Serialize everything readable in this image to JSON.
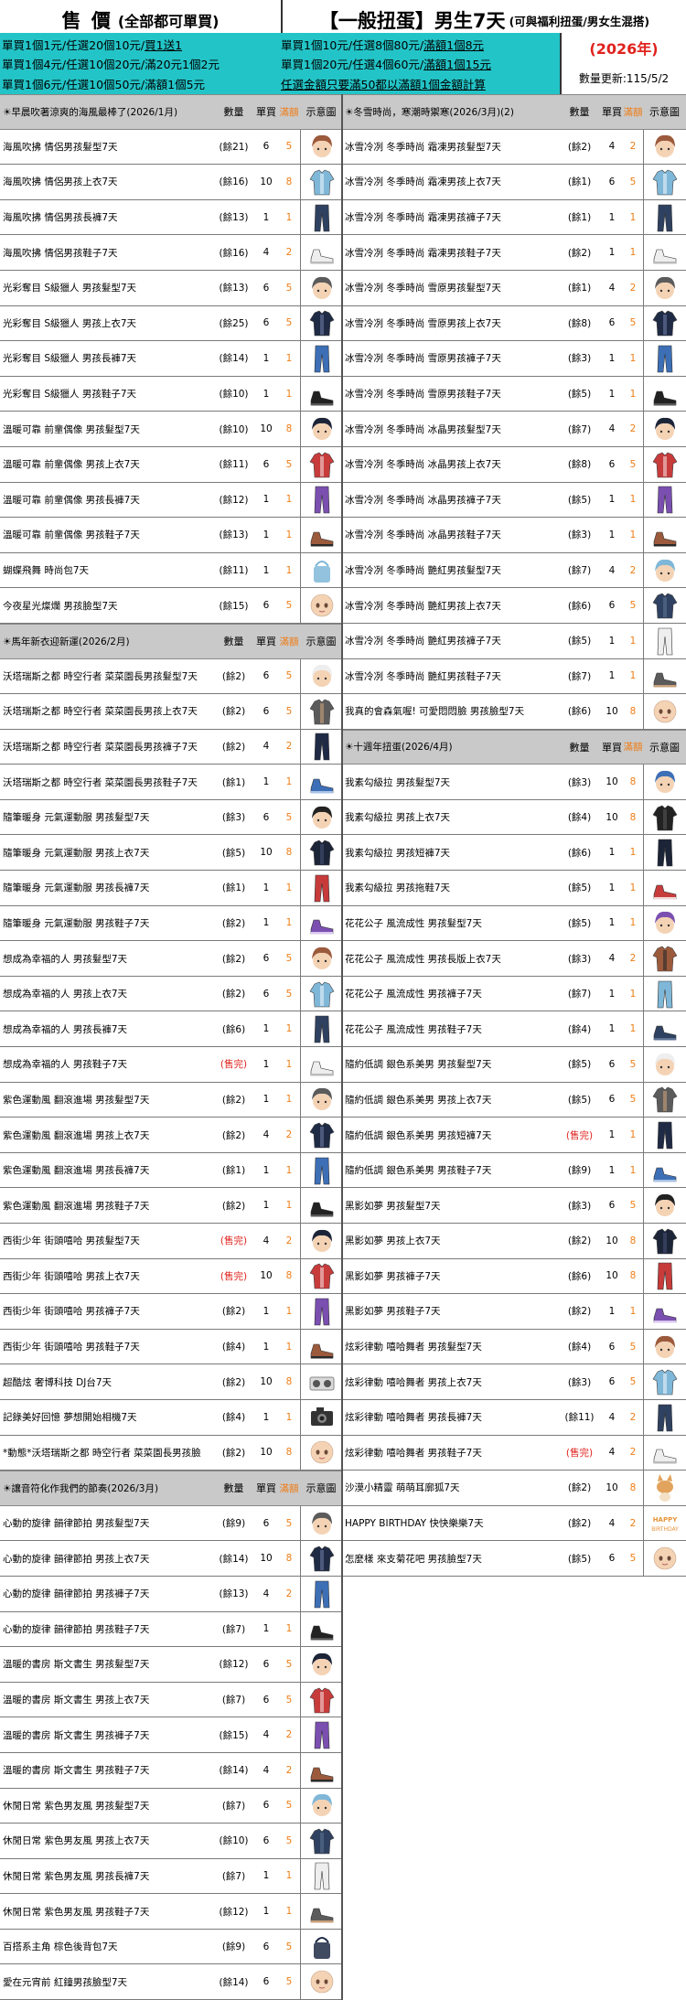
{
  "header": {
    "left_title": "售 價",
    "left_title_sub": "(全部都可單買)",
    "right_title": "【一般扭蛋】男生7天",
    "right_title_sub": "(可與福利扭蛋/男女生混搭)",
    "year": "(2026年)",
    "update": "數量更新:115/5/2",
    "left_lines": [
      {
        "a": "單買1個1元/任選20個10元/",
        "b": "買1送1"
      },
      {
        "a": "單買1個4元/任選10個20元/滿20元1個2元",
        "b": ""
      },
      {
        "a": "單買1個6元/任選10個50元/滿額1個5元",
        "b": ""
      }
    ],
    "right_lines": [
      {
        "a": "單買1個10元/任選8個80元/",
        "b": "滿額1個8元"
      },
      {
        "a": "單買1個20元/任選4個60元/",
        "b": "滿額1個15元"
      },
      {
        "a": "",
        "b": "任選金額只要滿50都以滿額1個金額計算"
      }
    ]
  },
  "columns": {
    "qty": "數量",
    "price": "單買",
    "full": "滿額",
    "img": "示意圖"
  },
  "left_sections": [
    {
      "title": "☀早晨吹著涼爽的海風最棒了(2026/1月)",
      "rows": [
        {
          "name": "海風吹拂 情侶男孩髮型7天",
          "qty": "(餘21)",
          "price": "6",
          "full": "5",
          "thumb": "hair"
        },
        {
          "name": "海風吹拂 情侶男孩上衣7天",
          "qty": "(餘16)",
          "price": "10",
          "full": "8",
          "thumb": "top"
        },
        {
          "name": "海風吹拂 情侶男孩長褲7天",
          "qty": "(餘13)",
          "price": "1",
          "full": "1",
          "thumb": "pants"
        },
        {
          "name": "海風吹拂 情侶男孩鞋子7天",
          "qty": "(餘16)",
          "price": "4",
          "full": "2",
          "thumb": "shoes"
        },
        {
          "name": "光彩奪目 S級獵人 男孩髮型7天",
          "qty": "(餘13)",
          "price": "6",
          "full": "5",
          "thumb": "hair"
        },
        {
          "name": "光彩奪目 S級獵人 男孩上衣7天",
          "qty": "(餘25)",
          "price": "6",
          "full": "5",
          "thumb": "top"
        },
        {
          "name": "光彩奪目 S級獵人 男孩長褲7天",
          "qty": "(餘14)",
          "price": "1",
          "full": "1",
          "thumb": "pants"
        },
        {
          "name": "光彩奪目 S級獵人 男孩鞋子7天",
          "qty": "(餘10)",
          "price": "1",
          "full": "1",
          "thumb": "shoes"
        },
        {
          "name": "溫暖可靠 前輩偶像 男孩髮型7天",
          "qty": "(餘10)",
          "price": "10",
          "full": "8",
          "thumb": "hair"
        },
        {
          "name": "溫暖可靠 前輩偶像 男孩上衣7天",
          "qty": "(餘11)",
          "price": "6",
          "full": "5",
          "thumb": "top"
        },
        {
          "name": "溫暖可靠 前輩偶像 男孩長褲7天",
          "qty": "(餘12)",
          "price": "1",
          "full": "1",
          "thumb": "pants"
        },
        {
          "name": "溫暖可靠 前輩偶像 男孩鞋子7天",
          "qty": "(餘13)",
          "price": "1",
          "full": "1",
          "thumb": "shoes"
        },
        {
          "name": "蝴蝶飛舞 時尚包7天",
          "qty": "(餘11)",
          "price": "1",
          "full": "1",
          "thumb": "bag"
        },
        {
          "name": "今夜星光燦爛 男孩臉型7天",
          "qty": "(餘15)",
          "price": "6",
          "full": "5",
          "thumb": "face"
        }
      ]
    },
    {
      "title": "☀馬年新衣迎新運(2026/2月)",
      "rows": [
        {
          "name": "沃塔瑞斯之都 時空行者 菜菜園長男孩髮型7天",
          "qty": "(餘2)",
          "price": "6",
          "full": "5",
          "thumb": "hair"
        },
        {
          "name": "沃塔瑞斯之都 時空行者 菜菜園長男孩上衣7天",
          "qty": "(餘2)",
          "price": "6",
          "full": "5",
          "thumb": "top"
        },
        {
          "name": "沃塔瑞斯之都 時空行者 菜菜園長男孩褲子7天",
          "qty": "(餘2)",
          "price": "4",
          "full": "2",
          "thumb": "pants"
        },
        {
          "name": "沃塔瑞斯之都 時空行者 菜菜園長男孩鞋子7天",
          "qty": "(餘1)",
          "price": "1",
          "full": "1",
          "thumb": "shoes"
        },
        {
          "name": "隨筆暖身 元氣運動服 男孩髮型7天",
          "qty": "(餘3)",
          "price": "6",
          "full": "5",
          "thumb": "hair"
        },
        {
          "name": "隨筆暖身 元氣運動服 男孩上衣7天",
          "qty": "(餘5)",
          "price": "10",
          "full": "8",
          "thumb": "top"
        },
        {
          "name": "隨筆暖身 元氣運動服 男孩長褲7天",
          "qty": "(餘1)",
          "price": "1",
          "full": "1",
          "thumb": "pants"
        },
        {
          "name": "隨筆暖身 元氣運動服 男孩鞋子7天",
          "qty": "(餘2)",
          "price": "1",
          "full": "1",
          "thumb": "shoes"
        },
        {
          "name": "想成為幸福的人 男孩髮型7天",
          "qty": "(餘2)",
          "price": "6",
          "full": "5",
          "thumb": "hair"
        },
        {
          "name": "想成為幸福的人 男孩上衣7天",
          "qty": "(餘2)",
          "price": "6",
          "full": "5",
          "thumb": "top"
        },
        {
          "name": "想成為幸福的人 男孩長褲7天",
          "qty": "(餘6)",
          "price": "1",
          "full": "1",
          "thumb": "pants"
        },
        {
          "name": "想成為幸福的人 男孩鞋子7天",
          "qty": "(售完)",
          "price": "1",
          "full": "1",
          "thumb": "shoes",
          "sold": true
        },
        {
          "name": "紫色運動風 翻滾進場 男孩髮型7天",
          "qty": "(餘2)",
          "price": "1",
          "full": "1",
          "thumb": "hair"
        },
        {
          "name": "紫色運動風 翻滾進場 男孩上衣7天",
          "qty": "(餘2)",
          "price": "4",
          "full": "2",
          "thumb": "top"
        },
        {
          "name": "紫色運動風 翻滾進場 男孩長褲7天",
          "qty": "(餘1)",
          "price": "1",
          "full": "1",
          "thumb": "pants"
        },
        {
          "name": "紫色運動風 翻滾進場 男孩鞋子7天",
          "qty": "(餘2)",
          "price": "1",
          "full": "1",
          "thumb": "shoes"
        },
        {
          "name": "西街少年 街頭嘻哈 男孩髮型7天",
          "qty": "(售完)",
          "price": "4",
          "full": "2",
          "thumb": "hair",
          "sold": true
        },
        {
          "name": "西街少年 街頭嘻哈 男孩上衣7天",
          "qty": "(售完)",
          "price": "10",
          "full": "8",
          "thumb": "top",
          "sold": true
        },
        {
          "name": "西街少年 街頭嘻哈 男孩褲子7天",
          "qty": "(餘2)",
          "price": "1",
          "full": "1",
          "thumb": "pants"
        },
        {
          "name": "西街少年 街頭嘻哈 男孩鞋子7天",
          "qty": "(餘4)",
          "price": "1",
          "full": "1",
          "thumb": "shoes"
        },
        {
          "name": "超酷炫 奢博科技 DJ台7天",
          "qty": "(餘2)",
          "price": "10",
          "full": "8",
          "thumb": "dj"
        },
        {
          "name": "記錄美好回憶 夢想開始相機7天",
          "qty": "(餘4)",
          "price": "1",
          "full": "1",
          "thumb": "camera"
        },
        {
          "name": "*動態*沃塔瑞斯之都 時空行者 菜菜園長男孩臉",
          "qty": "(餘2)",
          "price": "10",
          "full": "8",
          "thumb": "face"
        }
      ]
    },
    {
      "title": "☀讓音符化作我們的節奏(2026/3月)",
      "rows": [
        {
          "name": "心動的旋律 韻律節拍 男孩髮型7天",
          "qty": "(餘9)",
          "price": "6",
          "full": "5",
          "thumb": "hair"
        },
        {
          "name": "心動的旋律 韻律節拍 男孩上衣7天",
          "qty": "(餘14)",
          "price": "10",
          "full": "8",
          "thumb": "top"
        },
        {
          "name": "心動的旋律 韻律節拍 男孩褲子7天",
          "qty": "(餘13)",
          "price": "4",
          "full": "2",
          "thumb": "pants"
        },
        {
          "name": "心動的旋律 韻律節拍 男孩鞋子7天",
          "qty": "(餘7)",
          "price": "1",
          "full": "1",
          "thumb": "shoes"
        },
        {
          "name": "溫暖的書房 斯文書生 男孩髮型7天",
          "qty": "(餘12)",
          "price": "6",
          "full": "5",
          "thumb": "hair"
        },
        {
          "name": "溫暖的書房 斯文書生 男孩上衣7天",
          "qty": "(餘7)",
          "price": "6",
          "full": "5",
          "thumb": "top"
        },
        {
          "name": "溫暖的書房 斯文書生 男孩褲子7天",
          "qty": "(餘15)",
          "price": "4",
          "full": "2",
          "thumb": "pants"
        },
        {
          "name": "溫暖的書房 斯文書生 男孩鞋子7天",
          "qty": "(餘14)",
          "price": "4",
          "full": "2",
          "thumb": "shoes"
        },
        {
          "name": "休閒日常 紫色男友風 男孩髮型7天",
          "qty": "(餘7)",
          "price": "6",
          "full": "5",
          "thumb": "hair"
        },
        {
          "name": "休閒日常 紫色男友風 男孩上衣7天",
          "qty": "(餘10)",
          "price": "6",
          "full": "5",
          "thumb": "top"
        },
        {
          "name": "休閒日常 紫色男友風 男孩長褲7天",
          "qty": "(餘7)",
          "price": "1",
          "full": "1",
          "thumb": "pants"
        },
        {
          "name": "休閒日常 紫色男友風 男孩鞋子7天",
          "qty": "(餘12)",
          "price": "1",
          "full": "1",
          "thumb": "shoes"
        },
        {
          "name": "百搭系主角 棕色後背包7天",
          "qty": "(餘9)",
          "price": "6",
          "full": "5",
          "thumb": "bag"
        },
        {
          "name": "愛在元宵前 紅鐘男孩臉型7天",
          "qty": "(餘14)",
          "price": "6",
          "full": "5",
          "thumb": "face"
        }
      ]
    }
  ],
  "right_sections": [
    {
      "title": "☀冬雪時尚，寒潮時禦寒(2026/3月)(2)",
      "rows": [
        {
          "name": "冰雪冷冽 冬季時尚 霜凍男孩髮型7天",
          "qty": "(餘2)",
          "price": "4",
          "full": "2",
          "thumb": "hair"
        },
        {
          "name": "冰雪冷冽 冬季時尚 霜凍男孩上衣7天",
          "qty": "(餘1)",
          "price": "6",
          "full": "5",
          "thumb": "top"
        },
        {
          "name": "冰雪冷冽 冬季時尚 霜凍男孩褲子7天",
          "qty": "(餘1)",
          "price": "1",
          "full": "1",
          "thumb": "pants"
        },
        {
          "name": "冰雪冷冽 冬季時尚 霜凍男孩鞋子7天",
          "qty": "(餘2)",
          "price": "1",
          "full": "1",
          "thumb": "shoes"
        },
        {
          "name": "冰雪冷冽 冬季時尚 雪原男孩髮型7天",
          "qty": "(餘1)",
          "price": "4",
          "full": "2",
          "thumb": "hair"
        },
        {
          "name": "冰雪冷冽 冬季時尚 雪原男孩上衣7天",
          "qty": "(餘8)",
          "price": "6",
          "full": "5",
          "thumb": "top"
        },
        {
          "name": "冰雪冷冽 冬季時尚 雪原男孩褲子7天",
          "qty": "(餘3)",
          "price": "1",
          "full": "1",
          "thumb": "pants"
        },
        {
          "name": "冰雪冷冽 冬季時尚 雪原男孩鞋子7天",
          "qty": "(餘5)",
          "price": "1",
          "full": "1",
          "thumb": "shoes"
        },
        {
          "name": "冰雪冷冽 冬季時尚 冰晶男孩髮型7天",
          "qty": "(餘7)",
          "price": "4",
          "full": "2",
          "thumb": "hair"
        },
        {
          "name": "冰雪冷冽 冬季時尚 冰晶男孩上衣7天",
          "qty": "(餘8)",
          "price": "6",
          "full": "5",
          "thumb": "top"
        },
        {
          "name": "冰雪冷冽 冬季時尚 冰晶男孩褲子7天",
          "qty": "(餘5)",
          "price": "1",
          "full": "1",
          "thumb": "pants"
        },
        {
          "name": "冰雪冷冽 冬季時尚 冰晶男孩鞋子7天",
          "qty": "(餘3)",
          "price": "1",
          "full": "1",
          "thumb": "shoes"
        },
        {
          "name": "冰雪冷冽 冬季時尚 艷紅男孩髮型7天",
          "qty": "(餘7)",
          "price": "4",
          "full": "2",
          "thumb": "hair"
        },
        {
          "name": "冰雪冷冽 冬季時尚 艷紅男孩上衣7天",
          "qty": "(餘6)",
          "price": "6",
          "full": "5",
          "thumb": "top"
        },
        {
          "name": "冰雪冷冽 冬季時尚 艷紅男孩褲子7天",
          "qty": "(餘5)",
          "price": "1",
          "full": "1",
          "thumb": "pants"
        },
        {
          "name": "冰雪冷冽 冬季時尚 艷紅男孩鞋子7天",
          "qty": "(餘7)",
          "price": "1",
          "full": "1",
          "thumb": "shoes"
        },
        {
          "name": "我真的會森氣喔! 可愛悶悶臉 男孩臉型7天",
          "qty": "(餘6)",
          "price": "10",
          "full": "8",
          "thumb": "face"
        }
      ]
    },
    {
      "title": "☀十週年扭蛋(2026/4月)",
      "rows": [
        {
          "name": "我素勾級拉 男孩髮型7天",
          "qty": "(餘3)",
          "price": "10",
          "full": "8",
          "thumb": "hair"
        },
        {
          "name": "我素勾級拉 男孩上衣7天",
          "qty": "(餘4)",
          "price": "10",
          "full": "8",
          "thumb": "top"
        },
        {
          "name": "我素勾級拉 男孩短褲7天",
          "qty": "(餘6)",
          "price": "1",
          "full": "1",
          "thumb": "pants"
        },
        {
          "name": "我素勾級拉 男孩拖鞋7天",
          "qty": "(餘5)",
          "price": "1",
          "full": "1",
          "thumb": "shoes"
        },
        {
          "name": "花花公子 風流成性 男孩髮型7天",
          "qty": "(餘5)",
          "price": "1",
          "full": "1",
          "thumb": "hair"
        },
        {
          "name": "花花公子 風流成性 男孩長版上衣7天",
          "qty": "(餘3)",
          "price": "4",
          "full": "2",
          "thumb": "top"
        },
        {
          "name": "花花公子 風流成性 男孩褲子7天",
          "qty": "(餘7)",
          "price": "1",
          "full": "1",
          "thumb": "pants"
        },
        {
          "name": "花花公子 風流成性 男孩鞋子7天",
          "qty": "(餘4)",
          "price": "1",
          "full": "1",
          "thumb": "shoes"
        },
        {
          "name": "隨約低調 銀色系美男 男孩髮型7天",
          "qty": "(餘5)",
          "price": "6",
          "full": "5",
          "thumb": "hair"
        },
        {
          "name": "隨約低調 銀色系美男 男孩上衣7天",
          "qty": "(餘5)",
          "price": "6",
          "full": "5",
          "thumb": "top"
        },
        {
          "name": "隨約低調 銀色系美男 男孩短褲7天",
          "qty": "(售完)",
          "price": "1",
          "full": "1",
          "thumb": "pants",
          "sold": true
        },
        {
          "name": "隨約低調 銀色系美男 男孩鞋子7天",
          "qty": "(餘9)",
          "price": "1",
          "full": "1",
          "thumb": "shoes"
        },
        {
          "name": "黑影如夢 男孩髮型7天",
          "qty": "(餘3)",
          "price": "6",
          "full": "5",
          "thumb": "hair"
        },
        {
          "name": "黑影如夢 男孩上衣7天",
          "qty": "(餘2)",
          "price": "10",
          "full": "8",
          "thumb": "top"
        },
        {
          "name": "黑影如夢 男孩褲子7天",
          "qty": "(餘6)",
          "price": "10",
          "full": "8",
          "thumb": "pants"
        },
        {
          "name": "黑影如夢 男孩鞋子7天",
          "qty": "(餘2)",
          "price": "1",
          "full": "1",
          "thumb": "shoes"
        },
        {
          "name": "炫彩律動 嘻哈舞者 男孩髮型7天",
          "qty": "(餘4)",
          "price": "6",
          "full": "5",
          "thumb": "hair"
        },
        {
          "name": "炫彩律動 嘻哈舞者 男孩上衣7天",
          "qty": "(餘3)",
          "price": "6",
          "full": "5",
          "thumb": "top"
        },
        {
          "name": "炫彩律動 嘻哈舞者 男孩長褲7天",
          "qty": "(餘11)",
          "price": "4",
          "full": "2",
          "thumb": "pants"
        },
        {
          "name": "炫彩律動 嘻哈舞者 男孩鞋子7天",
          "qty": "(售完)",
          "price": "4",
          "full": "2",
          "thumb": "shoes",
          "sold": true
        },
        {
          "name": "沙漠小精靈 萌萌耳廓狐7天",
          "qty": "(餘2)",
          "price": "10",
          "full": "8",
          "thumb": "fox"
        },
        {
          "name": "HAPPY BIRTHDAY 快快樂樂7天",
          "qty": "(餘2)",
          "price": "4",
          "full": "2",
          "thumb": "bday"
        },
        {
          "name": "怎麼樣 來支菊花吧 男孩臉型7天",
          "qty": "(餘5)",
          "price": "6",
          "full": "5",
          "thumb": "face"
        }
      ]
    }
  ],
  "colors": {
    "teal": "#23c4c7",
    "orange": "#ef7d16",
    "red": "#e0221c",
    "section_gray": "#c9c9c9"
  }
}
